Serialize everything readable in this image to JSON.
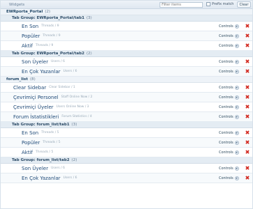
{
  "toolbar": {
    "title": "Widgets",
    "filter_placeholder": "Filter items",
    "prefix_label": "Prefix match",
    "clear_label": "Clear"
  },
  "list": [
    {
      "kind": "cat",
      "title": "EWRporta_Portal",
      "count": "(2)"
    },
    {
      "kind": "group",
      "title": "Tab Group: EWRporta_Portal/tab1",
      "count": "(3)"
    },
    {
      "kind": "tab",
      "title": "En Son",
      "meta": "Threads / 9"
    },
    {
      "kind": "tab",
      "title": "Popüler",
      "meta": "Threads / 9"
    },
    {
      "kind": "tab",
      "title": "Aktif",
      "meta": "Threads / 9"
    },
    {
      "kind": "group",
      "title": "Tab Group: EWRporta_Portal/tab2",
      "count": "(2)"
    },
    {
      "kind": "tab",
      "title": "Son Üyeler",
      "meta": "Users / 6"
    },
    {
      "kind": "tab",
      "title": "En Çok Yazanlar",
      "meta": "Users / 6"
    },
    {
      "kind": "cat",
      "title": "forum_list",
      "count": "(8)"
    },
    {
      "kind": "top",
      "title": "Clear Sidebar",
      "meta": "Clear Sidebar / 1"
    },
    {
      "kind": "top",
      "title": "Çevrimiçi Personel",
      "meta": "Staff Online Now / 2"
    },
    {
      "kind": "top",
      "title": "Çevrimiçi Üyeler",
      "meta": "Users Online Now / 3"
    },
    {
      "kind": "top",
      "title": "Forum İstatistikleri",
      "meta": "Forum Statistics / 4"
    },
    {
      "kind": "group",
      "title": "Tab Group: forum_list/tab1",
      "count": "(3)"
    },
    {
      "kind": "tab",
      "title": "En Son",
      "meta": "Threads / 5"
    },
    {
      "kind": "tab",
      "title": "Popüler",
      "meta": "Threads / 5"
    },
    {
      "kind": "tab",
      "title": "Aktif",
      "meta": "Threads / 5"
    },
    {
      "kind": "group",
      "title": "Tab Group: forum_list/tab2",
      "count": "(2)"
    },
    {
      "kind": "tab",
      "title": "Son Üyeler",
      "meta": "Users / 6"
    },
    {
      "kind": "tab",
      "title": "En Çok Yazanlar",
      "meta": "Users / 6"
    }
  ],
  "controls_label": "Controls",
  "delete_icon": "delete-x-icon",
  "accent": "#1f4a78",
  "delete_color": "#d2281f"
}
